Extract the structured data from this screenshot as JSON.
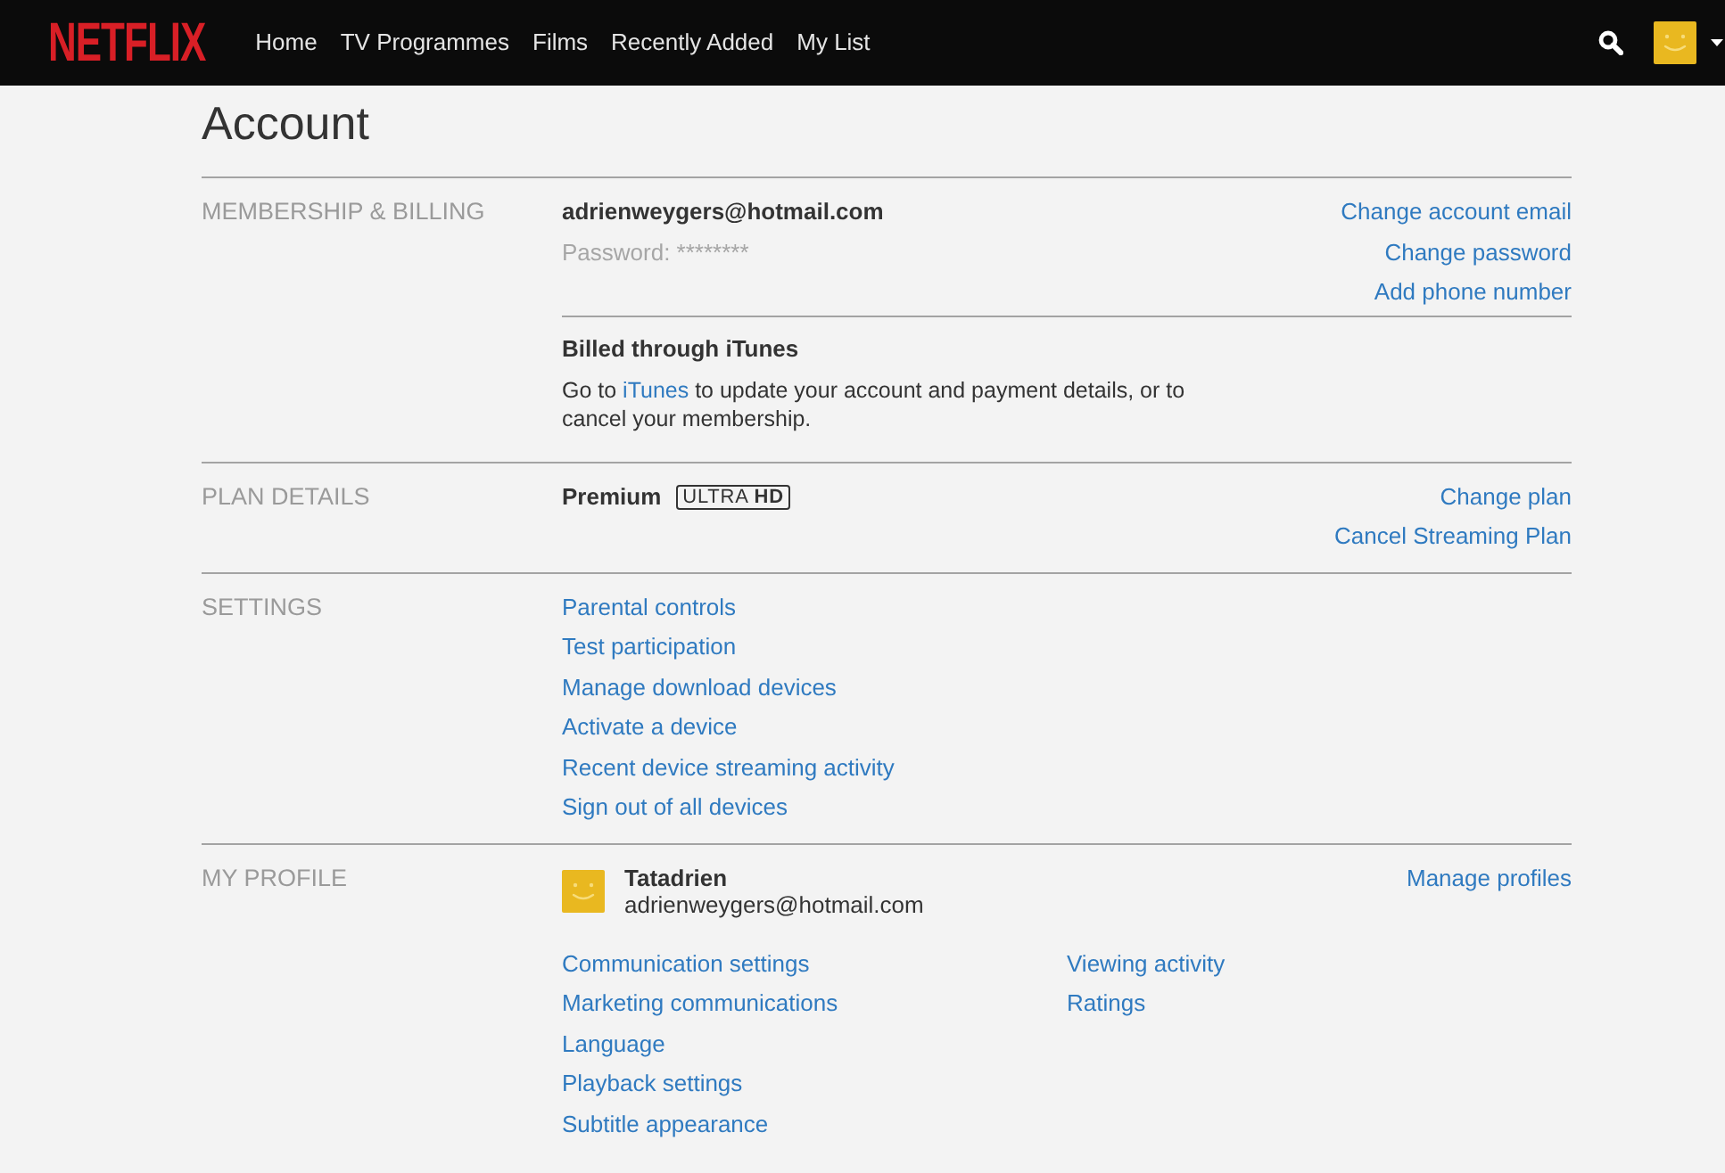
{
  "header": {
    "logo": "NETFLIX",
    "nav": [
      "Home",
      "TV Programmes",
      "Films",
      "Recently Added",
      "My List"
    ]
  },
  "page_title": "Account",
  "sections": [
    {
      "kind": "membership",
      "heading": "MEMBERSHIP & BILLING",
      "email": "adrienweygers@hotmail.com",
      "password": "Password: ********",
      "links": [
        "Change account email",
        "Change password",
        "Add phone number"
      ],
      "billing": {
        "title": "Billed through iTunes",
        "text_before": "Go to ",
        "link": "iTunes",
        "text_after": " to update your account and payment details, or to cancel your membership."
      }
    },
    {
      "kind": "plan",
      "heading": "PLAN DETAILS",
      "plan": "Premium",
      "badge": "ULTRA **HD**",
      "links": [
        "Change plan",
        "Cancel Streaming Plan"
      ]
    },
    {
      "kind": "settings",
      "heading": "SETTINGS",
      "links": [
        "Parental controls",
        "Test participation",
        "Manage download devices",
        "Activate a device",
        "Recent device streaming activity",
        "Sign out of all devices"
      ]
    },
    {
      "kind": "profile",
      "heading": "MY PROFILE",
      "profile_name": "Tatadrien",
      "profile_email": "adrienweygers@hotmail.com",
      "links": [
        "Manage profiles"
      ],
      "columns": [
        [
          "Communication settings",
          "Marketing communications",
          "Language",
          "Playback settings",
          "Subtitle appearance"
        ],
        [
          "Viewing activity",
          "Ratings"
        ]
      ]
    }
  ]
}
